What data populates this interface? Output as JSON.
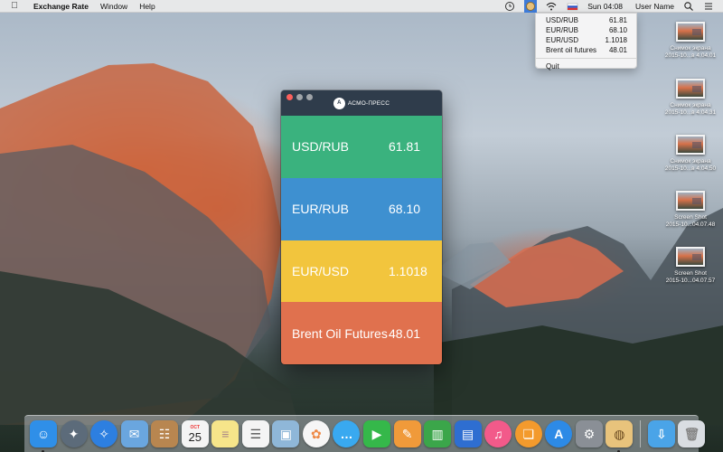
{
  "menubar": {
    "app_name": "Exchange Rate",
    "menus": [
      "Window",
      "Help"
    ],
    "clock": "Sun 04:08",
    "user": "User Name"
  },
  "status_menu": {
    "items": [
      {
        "label": "USD/RUB",
        "value": "61.81"
      },
      {
        "label": "EUR/RUB",
        "value": "68.10"
      },
      {
        "label": "EUR/USD",
        "value": "1.1018"
      },
      {
        "label": "Brent oil futures",
        "value": "48.01"
      }
    ],
    "quit_label": "Quit"
  },
  "window": {
    "brand": "АСМО-ПРЕСС",
    "brand_mark": "А",
    "rates": [
      {
        "label": "USD/RUB",
        "value": "61.81",
        "color": "#3ab27e"
      },
      {
        "label": "EUR/RUB",
        "value": "68.10",
        "color": "#3e90d0"
      },
      {
        "label": "EUR/USD",
        "value": "1.1018",
        "color": "#f2c53d"
      },
      {
        "label": "Brent Oil Futures",
        "value": "48.01",
        "color": "#e0714e"
      }
    ]
  },
  "desktop_icons": [
    {
      "line1": "Снимок экрана",
      "line2": "2015-10...в 4.04.01"
    },
    {
      "line1": "Снимок экрана",
      "line2": "2015-10...в 4.04.31"
    },
    {
      "line1": "Снимок экрана",
      "line2": "2015-10...в 4.04.50"
    },
    {
      "line1": "Screen Shot",
      "line2": "2015-10...04.07.48"
    },
    {
      "line1": "Screen Shot",
      "line2": "2015-10...04.07.57"
    }
  ],
  "dock": {
    "calendar_month": "OCT",
    "calendar_day": "25",
    "apps": [
      {
        "name": "finder-icon",
        "color": "#2f8fe8"
      },
      {
        "name": "launchpad-icon",
        "color": "#5c6b7a"
      },
      {
        "name": "safari-icon",
        "color": "#2d7fe0"
      },
      {
        "name": "mail-icon",
        "color": "#6aa6df"
      },
      {
        "name": "contacts-icon",
        "color": "#b88650"
      },
      {
        "name": "calendar-icon",
        "color": "#f4f4f4"
      },
      {
        "name": "notes-icon",
        "color": "#f6e58a"
      },
      {
        "name": "reminders-icon",
        "color": "#f4f4f4"
      },
      {
        "name": "preview-icon",
        "color": "#8fb7d8"
      },
      {
        "name": "photos-icon",
        "color": "#f6f6f6"
      },
      {
        "name": "messages-icon",
        "color": "#39a9f0"
      },
      {
        "name": "facetime-icon",
        "color": "#35b84a"
      },
      {
        "name": "pages-icon",
        "color": "#f09a3a"
      },
      {
        "name": "numbers-icon",
        "color": "#3ba64a"
      },
      {
        "name": "keynote-icon",
        "color": "#2e6ed1"
      },
      {
        "name": "itunes-icon",
        "color": "#f25a8a"
      },
      {
        "name": "ibooks-icon",
        "color": "#f39a2d"
      },
      {
        "name": "app-store-icon",
        "color": "#2d8ae6"
      },
      {
        "name": "system-preferences-icon",
        "color": "#8a8f96"
      },
      {
        "name": "exchange-rate-icon",
        "color": "#e8c37c"
      }
    ],
    "downloads_color": "#4aa4e8",
    "trash_color": "#d9dde2"
  },
  "colors": {
    "menubar_bg": "#ececec",
    "window_titlebar": "#2f3c4b",
    "status_highlight": "#3d7bd8"
  }
}
